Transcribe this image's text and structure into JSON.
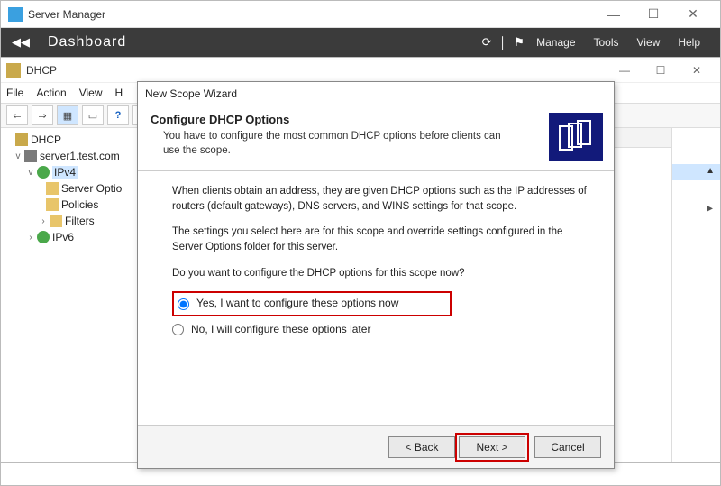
{
  "sm": {
    "title": "Server Manager",
    "dashboard": "Dashboard",
    "menu": {
      "manage": "Manage",
      "tools": "Tools",
      "view": "View",
      "help": "Help"
    }
  },
  "dhcp": {
    "title": "DHCP",
    "menu": {
      "file": "File",
      "action": "Action",
      "view": "View",
      "h": "H"
    },
    "tree": {
      "root": "DHCP",
      "server": "server1.test.com",
      "ipv4": "IPv4",
      "serverOptions": "Server Optio",
      "policies": "Policies",
      "filters": "Filters",
      "ipv6": "IPv6"
    }
  },
  "wizard": {
    "windowTitle": "New Scope Wizard",
    "heading": "Configure DHCP Options",
    "sub": "You have to configure the most common DHCP options before clients can use the scope.",
    "p1": "When clients obtain an address, they are given DHCP options such as the IP addresses of routers (default gateways), DNS servers, and WINS settings for that scope.",
    "p2": "The settings you select here are for this scope and override settings configured in the Server Options folder for this server.",
    "p3": "Do you want to configure the DHCP options for this scope now?",
    "optYes": "Yes, I want to configure these options now",
    "optNo": "No, I will configure these options later",
    "btnBack": "< Back",
    "btnNext": "Next >",
    "btnCancel": "Cancel"
  }
}
